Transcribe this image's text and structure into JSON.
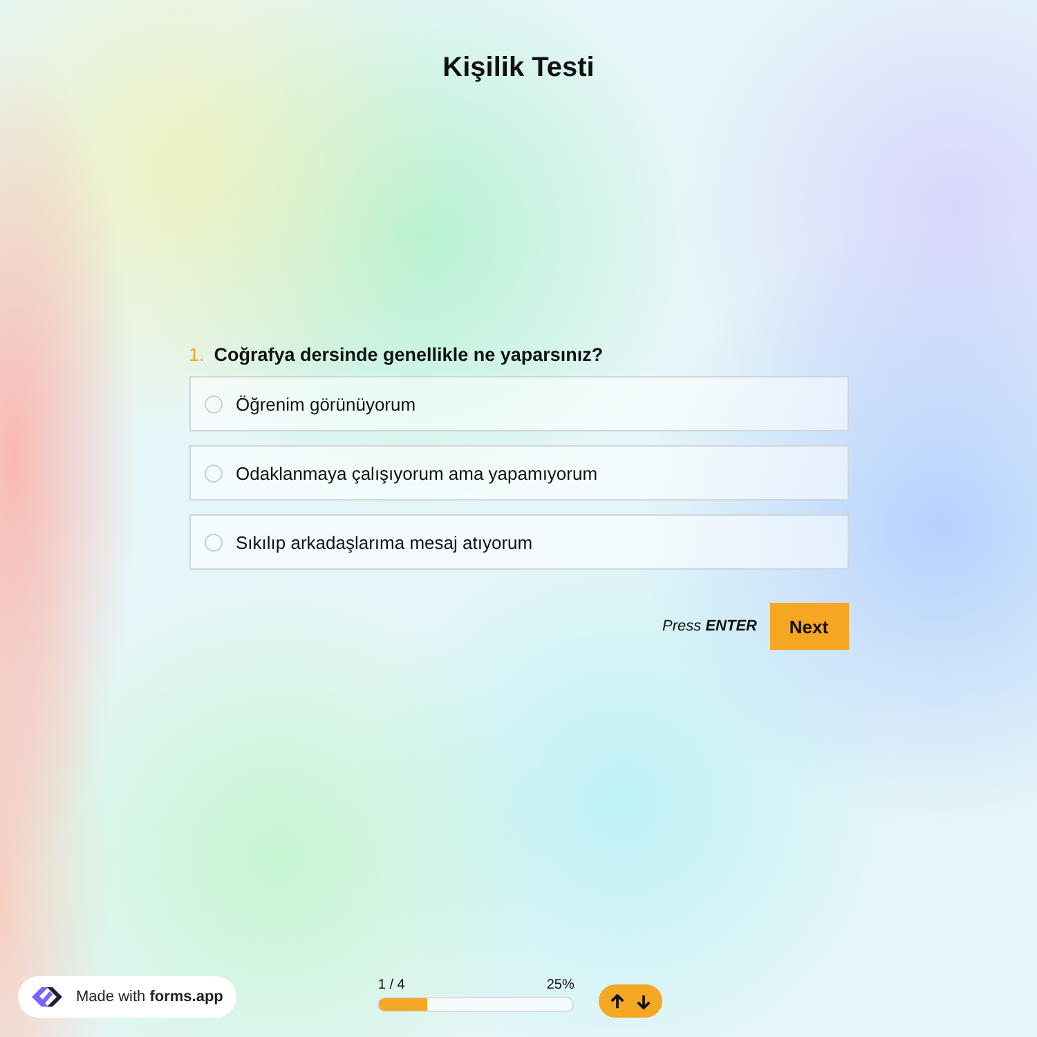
{
  "title": "Kişilik Testi",
  "question": {
    "number": "1.",
    "text": "Coğrafya dersinde genellikle ne yaparsınız?",
    "options": [
      {
        "label": "Öğrenim görünüyorum",
        "selected": false
      },
      {
        "label": "Odaklanmaya çalışıyorum ama yapamıyorum",
        "selected": false
      },
      {
        "label": "Sıkılıp arkadaşlarıma mesaj atıyorum",
        "selected": false
      }
    ]
  },
  "hint": "Press **ENTER**",
  "next_button": "Next",
  "badge": "Made with **forms.app**",
  "progress": {
    "step": "1 / 4",
    "percent": "25%",
    "level": 0.25
  }
}
